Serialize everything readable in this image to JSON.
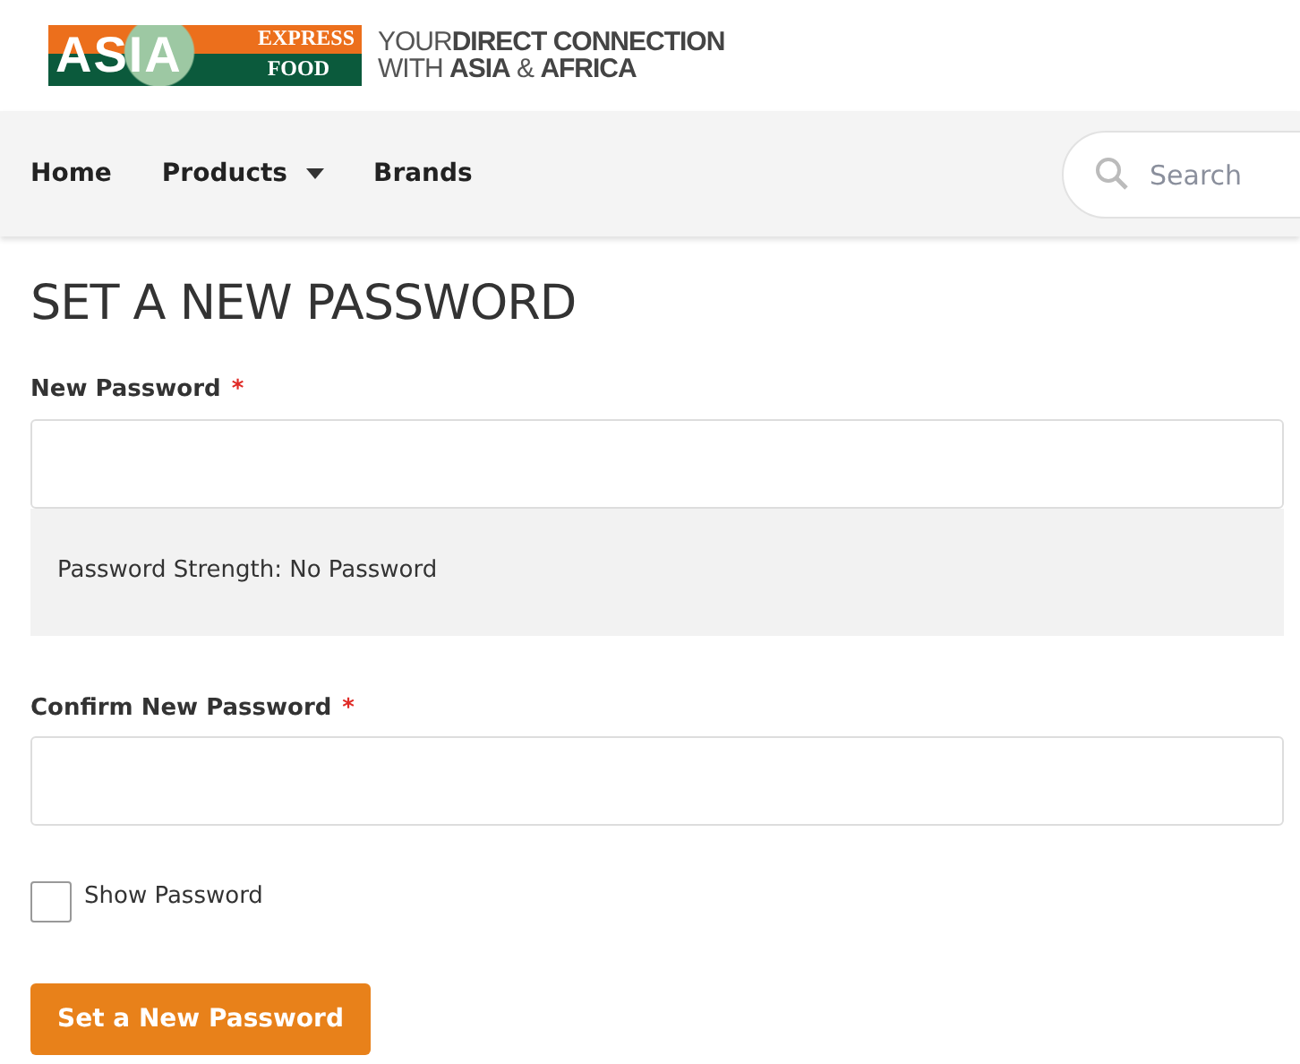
{
  "logo": {
    "word": "ASIA",
    "line_1": "EXPRESS",
    "line_2": "FOOD"
  },
  "tagline": {
    "line_1_light": "YOUR",
    "line_1_bold": "DIRECT CONNECTION",
    "line_2_light": "WITH",
    "line_2_bold_1": "ASIA",
    "line_2_amp": "&",
    "line_2_bold_2": "AFRICA"
  },
  "nav": [
    {
      "label": "Home",
      "has_dropdown": false
    },
    {
      "label": "Products",
      "has_dropdown": true
    },
    {
      "label": "Brands",
      "has_dropdown": false
    }
  ],
  "search": {
    "placeholder": "Search"
  },
  "heading": "SET A NEW PASSWORD",
  "new_password": {
    "label": "New Password",
    "required_mark": "*"
  },
  "strength": "Password Strength: No Password",
  "confirm_password": {
    "label": "Confirm New Password",
    "required_mark": "*"
  },
  "show_password": {
    "label": "Show Password",
    "checked": false
  },
  "submit": "Set a New Password"
}
